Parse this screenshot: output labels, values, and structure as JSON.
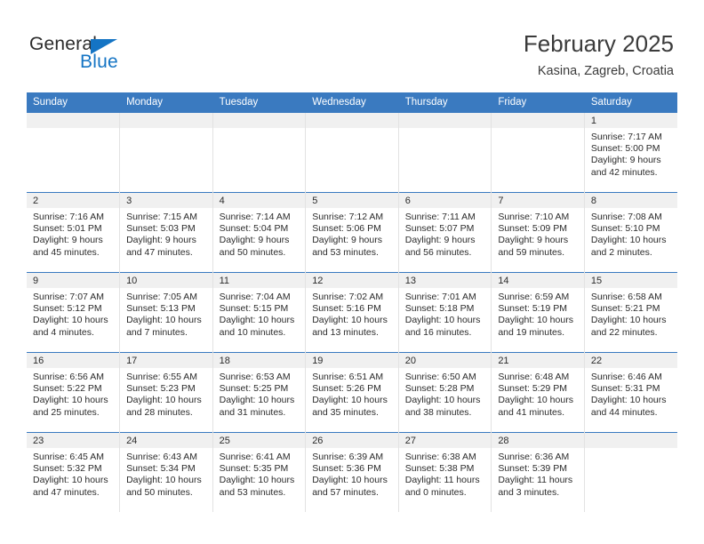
{
  "brand": {
    "name_part1": "General",
    "name_part2": "Blue",
    "accent_color": "#1474c4"
  },
  "header": {
    "title": "February 2025",
    "location": "Kasina, Zagreb, Croatia",
    "header_bg_color": "#3a7ac0"
  },
  "calendar": {
    "weekday_headers": [
      "Sunday",
      "Monday",
      "Tuesday",
      "Wednesday",
      "Thursday",
      "Friday",
      "Saturday"
    ],
    "weeks": [
      [
        {
          "day": "",
          "lines": []
        },
        {
          "day": "",
          "lines": []
        },
        {
          "day": "",
          "lines": []
        },
        {
          "day": "",
          "lines": []
        },
        {
          "day": "",
          "lines": []
        },
        {
          "day": "",
          "lines": []
        },
        {
          "day": "1",
          "lines": [
            "Sunrise: 7:17 AM",
            "Sunset: 5:00 PM",
            "Daylight: 9 hours",
            "and 42 minutes."
          ]
        }
      ],
      [
        {
          "day": "2",
          "lines": [
            "Sunrise: 7:16 AM",
            "Sunset: 5:01 PM",
            "Daylight: 9 hours",
            "and 45 minutes."
          ]
        },
        {
          "day": "3",
          "lines": [
            "Sunrise: 7:15 AM",
            "Sunset: 5:03 PM",
            "Daylight: 9 hours",
            "and 47 minutes."
          ]
        },
        {
          "day": "4",
          "lines": [
            "Sunrise: 7:14 AM",
            "Sunset: 5:04 PM",
            "Daylight: 9 hours",
            "and 50 minutes."
          ]
        },
        {
          "day": "5",
          "lines": [
            "Sunrise: 7:12 AM",
            "Sunset: 5:06 PM",
            "Daylight: 9 hours",
            "and 53 minutes."
          ]
        },
        {
          "day": "6",
          "lines": [
            "Sunrise: 7:11 AM",
            "Sunset: 5:07 PM",
            "Daylight: 9 hours",
            "and 56 minutes."
          ]
        },
        {
          "day": "7",
          "lines": [
            "Sunrise: 7:10 AM",
            "Sunset: 5:09 PM",
            "Daylight: 9 hours",
            "and 59 minutes."
          ]
        },
        {
          "day": "8",
          "lines": [
            "Sunrise: 7:08 AM",
            "Sunset: 5:10 PM",
            "Daylight: 10 hours",
            "and 2 minutes."
          ]
        }
      ],
      [
        {
          "day": "9",
          "lines": [
            "Sunrise: 7:07 AM",
            "Sunset: 5:12 PM",
            "Daylight: 10 hours",
            "and 4 minutes."
          ]
        },
        {
          "day": "10",
          "lines": [
            "Sunrise: 7:05 AM",
            "Sunset: 5:13 PM",
            "Daylight: 10 hours",
            "and 7 minutes."
          ]
        },
        {
          "day": "11",
          "lines": [
            "Sunrise: 7:04 AM",
            "Sunset: 5:15 PM",
            "Daylight: 10 hours",
            "and 10 minutes."
          ]
        },
        {
          "day": "12",
          "lines": [
            "Sunrise: 7:02 AM",
            "Sunset: 5:16 PM",
            "Daylight: 10 hours",
            "and 13 minutes."
          ]
        },
        {
          "day": "13",
          "lines": [
            "Sunrise: 7:01 AM",
            "Sunset: 5:18 PM",
            "Daylight: 10 hours",
            "and 16 minutes."
          ]
        },
        {
          "day": "14",
          "lines": [
            "Sunrise: 6:59 AM",
            "Sunset: 5:19 PM",
            "Daylight: 10 hours",
            "and 19 minutes."
          ]
        },
        {
          "day": "15",
          "lines": [
            "Sunrise: 6:58 AM",
            "Sunset: 5:21 PM",
            "Daylight: 10 hours",
            "and 22 minutes."
          ]
        }
      ],
      [
        {
          "day": "16",
          "lines": [
            "Sunrise: 6:56 AM",
            "Sunset: 5:22 PM",
            "Daylight: 10 hours",
            "and 25 minutes."
          ]
        },
        {
          "day": "17",
          "lines": [
            "Sunrise: 6:55 AM",
            "Sunset: 5:23 PM",
            "Daylight: 10 hours",
            "and 28 minutes."
          ]
        },
        {
          "day": "18",
          "lines": [
            "Sunrise: 6:53 AM",
            "Sunset: 5:25 PM",
            "Daylight: 10 hours",
            "and 31 minutes."
          ]
        },
        {
          "day": "19",
          "lines": [
            "Sunrise: 6:51 AM",
            "Sunset: 5:26 PM",
            "Daylight: 10 hours",
            "and 35 minutes."
          ]
        },
        {
          "day": "20",
          "lines": [
            "Sunrise: 6:50 AM",
            "Sunset: 5:28 PM",
            "Daylight: 10 hours",
            "and 38 minutes."
          ]
        },
        {
          "day": "21",
          "lines": [
            "Sunrise: 6:48 AM",
            "Sunset: 5:29 PM",
            "Daylight: 10 hours",
            "and 41 minutes."
          ]
        },
        {
          "day": "22",
          "lines": [
            "Sunrise: 6:46 AM",
            "Sunset: 5:31 PM",
            "Daylight: 10 hours",
            "and 44 minutes."
          ]
        }
      ],
      [
        {
          "day": "23",
          "lines": [
            "Sunrise: 6:45 AM",
            "Sunset: 5:32 PM",
            "Daylight: 10 hours",
            "and 47 minutes."
          ]
        },
        {
          "day": "24",
          "lines": [
            "Sunrise: 6:43 AM",
            "Sunset: 5:34 PM",
            "Daylight: 10 hours",
            "and 50 minutes."
          ]
        },
        {
          "day": "25",
          "lines": [
            "Sunrise: 6:41 AM",
            "Sunset: 5:35 PM",
            "Daylight: 10 hours",
            "and 53 minutes."
          ]
        },
        {
          "day": "26",
          "lines": [
            "Sunrise: 6:39 AM",
            "Sunset: 5:36 PM",
            "Daylight: 10 hours",
            "and 57 minutes."
          ]
        },
        {
          "day": "27",
          "lines": [
            "Sunrise: 6:38 AM",
            "Sunset: 5:38 PM",
            "Daylight: 11 hours",
            "and 0 minutes."
          ]
        },
        {
          "day": "28",
          "lines": [
            "Sunrise: 6:36 AM",
            "Sunset: 5:39 PM",
            "Daylight: 11 hours",
            "and 3 minutes."
          ]
        },
        {
          "day": "",
          "lines": []
        }
      ]
    ]
  }
}
